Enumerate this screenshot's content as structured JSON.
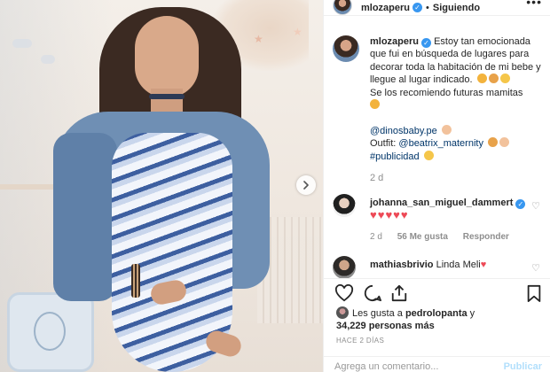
{
  "post": {
    "photo_description_icon": "carousel-next-icon"
  },
  "header": {
    "username": "mlozaperu",
    "separator": "•",
    "follow_status": "Siguiendo",
    "more_icon": "•••"
  },
  "caption": {
    "username": "mlozaperu",
    "text_1": "Estoy tan emocionada que fui en búsqueda de lugares para decorar toda la habitación de mi bebe y llegue al lugar indicado.",
    "text_2": "Se los recomiendo futuras mamitas",
    "mention_1": "@dinosbaby.pe",
    "outfit_label": "Outfit:",
    "mention_2": "@beatrix_maternity",
    "hashtag": "#publicidad",
    "time": "2 d"
  },
  "comments": [
    {
      "username": "johanna_san_miguel_dammert",
      "text": "♥♥♥♥♥",
      "time": "2 d",
      "likes": "56 Me gusta",
      "reply": "Responder"
    },
    {
      "username": "mathiasbrivio",
      "text": "Linda Meli",
      "heart": "♥"
    }
  ],
  "likes": {
    "prefix": "Les gusta a",
    "user": "pedrolopanta",
    "conjunction": "y",
    "count": "34,229 personas más"
  },
  "timestamp": "Hace 2 días",
  "add_comment": {
    "placeholder": "Agrega un comentario...",
    "publish": "Publicar"
  },
  "colors": {
    "verified": "#3897f0",
    "link": "#003569",
    "heart": "#ed4956",
    "publish_disabled": "#b2dffc"
  }
}
